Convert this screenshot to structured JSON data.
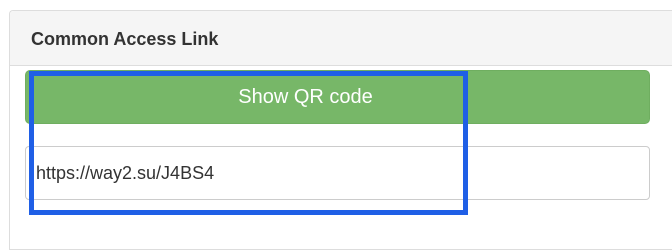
{
  "panel": {
    "title": "Common Access Link"
  },
  "qr_button": {
    "label": "Show QR code"
  },
  "link_field": {
    "value": "https://way2.su/J4BS4"
  },
  "colors": {
    "button_green": "#77b768",
    "highlight_blue": "#1f5fe6",
    "heading_bg": "#f5f5f5"
  }
}
